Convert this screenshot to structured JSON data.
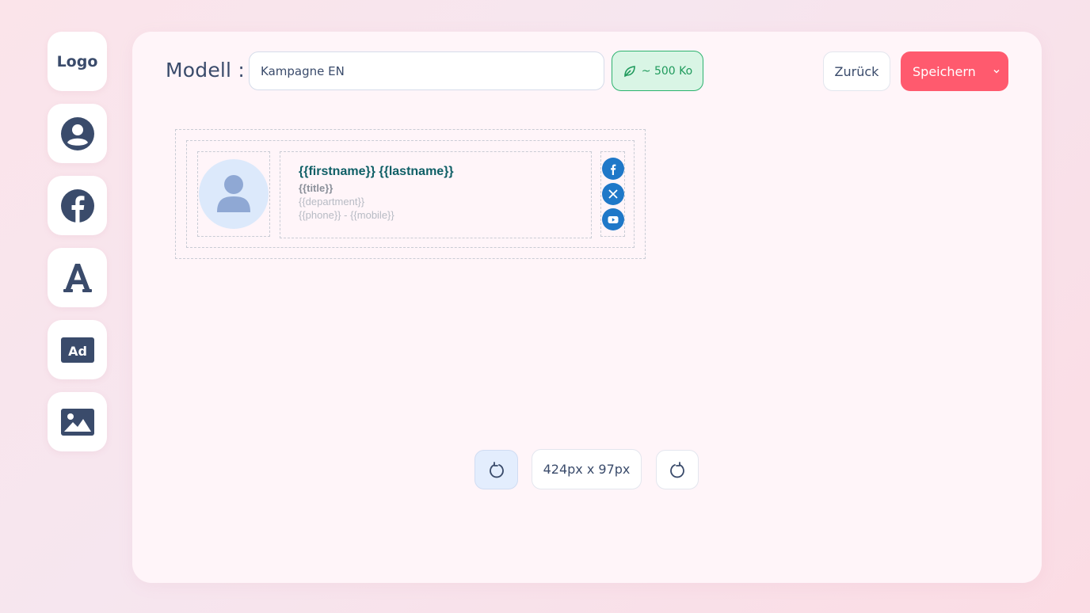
{
  "sidebar": {
    "logo_label": "Logo",
    "items": [
      {
        "icon": "user-circle-icon"
      },
      {
        "icon": "facebook-icon"
      },
      {
        "icon": "font-icon"
      },
      {
        "icon": "ad-icon"
      },
      {
        "icon": "image-icon"
      }
    ]
  },
  "header": {
    "model_label": "Modell :",
    "model_value": "Kampagne EN",
    "size_badge": "~ 500 Ko",
    "back_label": "Zurück",
    "save_label": "Speichern"
  },
  "signature": {
    "name": "{{firstname}} {{lastname}}",
    "title": "{{title}}",
    "department": "{{department}}",
    "phone_line": "{{phone}} - {{mobile}}",
    "social": [
      "facebook-icon",
      "x-icon",
      "youtube-icon"
    ]
  },
  "footer": {
    "dimensions": "424px x 97px"
  },
  "colors": {
    "primary_text": "#3a4b6b",
    "accent_save": "#ff5a6e",
    "badge_green": "#1f9a5c",
    "social_blue": "#1f78c8",
    "name_teal": "#0f5f66"
  }
}
